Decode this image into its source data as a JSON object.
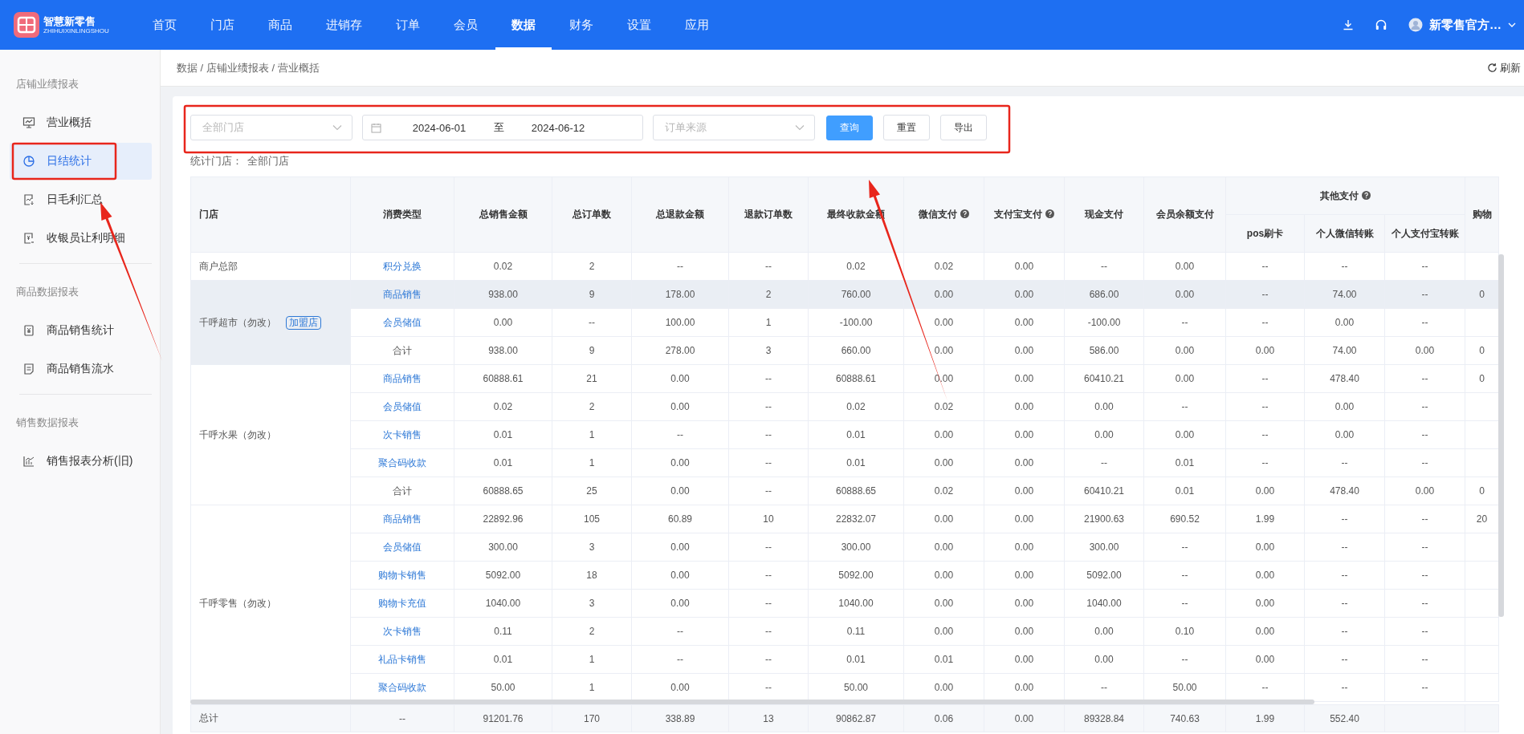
{
  "topbar": {
    "logo": {
      "title": "智慧新零售",
      "subtitle": "ZHIHUIXINLINGSHOU"
    },
    "nav": [
      {
        "label": "首页",
        "selected": false
      },
      {
        "label": "门店",
        "selected": false
      },
      {
        "label": "商品",
        "selected": false
      },
      {
        "label": "进销存",
        "selected": false
      },
      {
        "label": "订单",
        "selected": false
      },
      {
        "label": "会员",
        "selected": false
      },
      {
        "label": "数据",
        "selected": true
      },
      {
        "label": "财务",
        "selected": false
      },
      {
        "label": "设置",
        "selected": false
      },
      {
        "label": "应用",
        "selected": false
      }
    ],
    "user": "新零售官方…"
  },
  "breadcrumb": {
    "path": "数据 / 店铺业绩报表 / 营业概括",
    "refresh": "刷新"
  },
  "sidebar": {
    "sections": [
      {
        "title": "店铺业绩报表",
        "items": [
          {
            "label": "营业概括",
            "selected": false
          },
          {
            "label": "日结统计",
            "selected": true
          },
          {
            "label": "日毛利汇总",
            "selected": false
          },
          {
            "label": "收银员让利明细",
            "selected": false
          }
        ]
      },
      {
        "title": "商品数据报表",
        "items": [
          {
            "label": "商品销售统计",
            "selected": false
          },
          {
            "label": "商品销售流水",
            "selected": false
          }
        ]
      },
      {
        "title": "销售数据报表",
        "items": [
          {
            "label": "销售报表分析(旧)",
            "selected": false
          }
        ]
      }
    ]
  },
  "filter": {
    "store_select": {
      "placeholder": "全部门店"
    },
    "date_range": {
      "start": "2024-06-01",
      "separator": "至",
      "end": "2024-06-12"
    },
    "source_select": {
      "placeholder": "订单来源"
    },
    "buttons": [
      {
        "label": "查询",
        "kind": "primary"
      },
      {
        "label": "重置",
        "kind": "default"
      },
      {
        "label": "导出",
        "kind": "default"
      }
    ]
  },
  "scope": {
    "label": "统计门店：",
    "value": "全部门店"
  },
  "table": {
    "columns": [
      {
        "label": "门店",
        "help": false
      },
      {
        "label": "消费类型",
        "help": false
      },
      {
        "label": "总销售金额",
        "help": false
      },
      {
        "label": "总订单数",
        "help": false
      },
      {
        "label": "总退款金额",
        "help": false
      },
      {
        "label": "退款订单数",
        "help": false
      },
      {
        "label": "最终收款金额",
        "help": false
      },
      {
        "label": "微信支付",
        "help": true
      },
      {
        "label": "支付宝支付",
        "help": true
      },
      {
        "label": "现金支付",
        "help": false
      },
      {
        "label": "会员余额支付",
        "help": false
      },
      {
        "label": "其他支付",
        "help": true,
        "children": [
          {
            "label": "pos刷卡",
            "help": false
          },
          {
            "label": "个人微信转账",
            "help": false
          },
          {
            "label": "个人支付宝转账",
            "help": false
          }
        ]
      },
      {
        "label": "购物",
        "help": false
      }
    ],
    "groups": [
      {
        "store": "商户总部",
        "rows": [
          {
            "type": "积分兑换",
            "kind": "link",
            "hovered": false,
            "values": [
              "0.02",
              "2",
              "--",
              "--",
              "0.02",
              "0.02",
              "0.00",
              "--",
              "0.00",
              "--",
              "--",
              "--"
            ]
          }
        ]
      },
      {
        "store": "千呼超市（勿改）",
        "tag": "加盟店",
        "rows": [
          {
            "type": "商品销售",
            "kind": "link",
            "hovered": true,
            "values": [
              "938.00",
              "9",
              "178.00",
              "2",
              "760.00",
              "0.00",
              "0.00",
              "686.00",
              "0.00",
              "--",
              "74.00",
              "--",
              "0"
            ]
          },
          {
            "type": "会员储值",
            "kind": "link",
            "hovered": false,
            "values": [
              "0.00",
              "--",
              "100.00",
              "1",
              "-100.00",
              "0.00",
              "0.00",
              "-100.00",
              "--",
              "--",
              "0.00",
              "--"
            ]
          },
          {
            "type": "合计",
            "kind": "total",
            "hovered": false,
            "values": [
              "938.00",
              "9",
              "278.00",
              "3",
              "660.00",
              "0.00",
              "0.00",
              "586.00",
              "0.00",
              "0.00",
              "74.00",
              "0.00",
              "0"
            ]
          }
        ]
      },
      {
        "store": "千呼水果（勿改）",
        "rows": [
          {
            "type": "商品销售",
            "kind": "link",
            "hovered": false,
            "values": [
              "60888.61",
              "21",
              "0.00",
              "--",
              "60888.61",
              "0.00",
              "0.00",
              "60410.21",
              "0.00",
              "--",
              "478.40",
              "--",
              "0"
            ]
          },
          {
            "type": "会员储值",
            "kind": "link",
            "hovered": false,
            "values": [
              "0.02",
              "2",
              "0.00",
              "--",
              "0.02",
              "0.02",
              "0.00",
              "0.00",
              "--",
              "--",
              "0.00",
              "--"
            ]
          },
          {
            "type": "次卡销售",
            "kind": "link",
            "hovered": false,
            "values": [
              "0.01",
              "1",
              "--",
              "--",
              "0.01",
              "0.00",
              "0.00",
              "0.00",
              "0.00",
              "--",
              "0.00",
              "--"
            ]
          },
          {
            "type": "聚合码收款",
            "kind": "link",
            "hovered": false,
            "values": [
              "0.01",
              "1",
              "0.00",
              "--",
              "0.01",
              "0.00",
              "0.00",
              "--",
              "0.01",
              "--",
              "--",
              "--"
            ]
          },
          {
            "type": "合计",
            "kind": "total",
            "hovered": false,
            "values": [
              "60888.65",
              "25",
              "0.00",
              "--",
              "60888.65",
              "0.02",
              "0.00",
              "60410.21",
              "0.01",
              "0.00",
              "478.40",
              "0.00",
              "0"
            ]
          }
        ]
      },
      {
        "store": "千呼零售（勿改）",
        "rows": [
          {
            "type": "商品销售",
            "kind": "link",
            "hovered": false,
            "values": [
              "22892.96",
              "105",
              "60.89",
              "10",
              "22832.07",
              "0.00",
              "0.00",
              "21900.63",
              "690.52",
              "1.99",
              "--",
              "--",
              "20"
            ]
          },
          {
            "type": "会员储值",
            "kind": "link",
            "hovered": false,
            "values": [
              "300.00",
              "3",
              "0.00",
              "--",
              "300.00",
              "0.00",
              "0.00",
              "300.00",
              "--",
              "0.00",
              "--",
              "--"
            ]
          },
          {
            "type": "购物卡销售",
            "kind": "link",
            "hovered": false,
            "values": [
              "5092.00",
              "18",
              "0.00",
              "--",
              "5092.00",
              "0.00",
              "0.00",
              "5092.00",
              "--",
              "0.00",
              "--",
              "--"
            ]
          },
          {
            "type": "购物卡充值",
            "kind": "link",
            "hovered": false,
            "values": [
              "1040.00",
              "3",
              "0.00",
              "--",
              "1040.00",
              "0.00",
              "0.00",
              "1040.00",
              "--",
              "0.00",
              "--",
              "--"
            ]
          },
          {
            "type": "次卡销售",
            "kind": "link",
            "hovered": false,
            "values": [
              "0.11",
              "2",
              "--",
              "--",
              "0.11",
              "0.00",
              "0.00",
              "0.00",
              "0.10",
              "0.00",
              "--",
              "--"
            ]
          },
          {
            "type": "礼品卡销售",
            "kind": "link",
            "hovered": false,
            "values": [
              "0.01",
              "1",
              "--",
              "--",
              "0.01",
              "0.01",
              "0.00",
              "0.00",
              "--",
              "0.00",
              "--",
              "--"
            ]
          },
          {
            "type": "聚合码收款",
            "kind": "link",
            "hovered": false,
            "values": [
              "50.00",
              "1",
              "0.00",
              "--",
              "50.00",
              "0.00",
              "0.00",
              "--",
              "50.00",
              "--",
              "--",
              "--"
            ]
          }
        ]
      }
    ],
    "total": {
      "label": "总计",
      "type": "--",
      "values": [
        "91201.76",
        "170",
        "338.89",
        "13",
        "90862.87",
        "0.06",
        "0.00",
        "89328.84",
        "740.63",
        "1.99",
        "552.40"
      ]
    }
  }
}
